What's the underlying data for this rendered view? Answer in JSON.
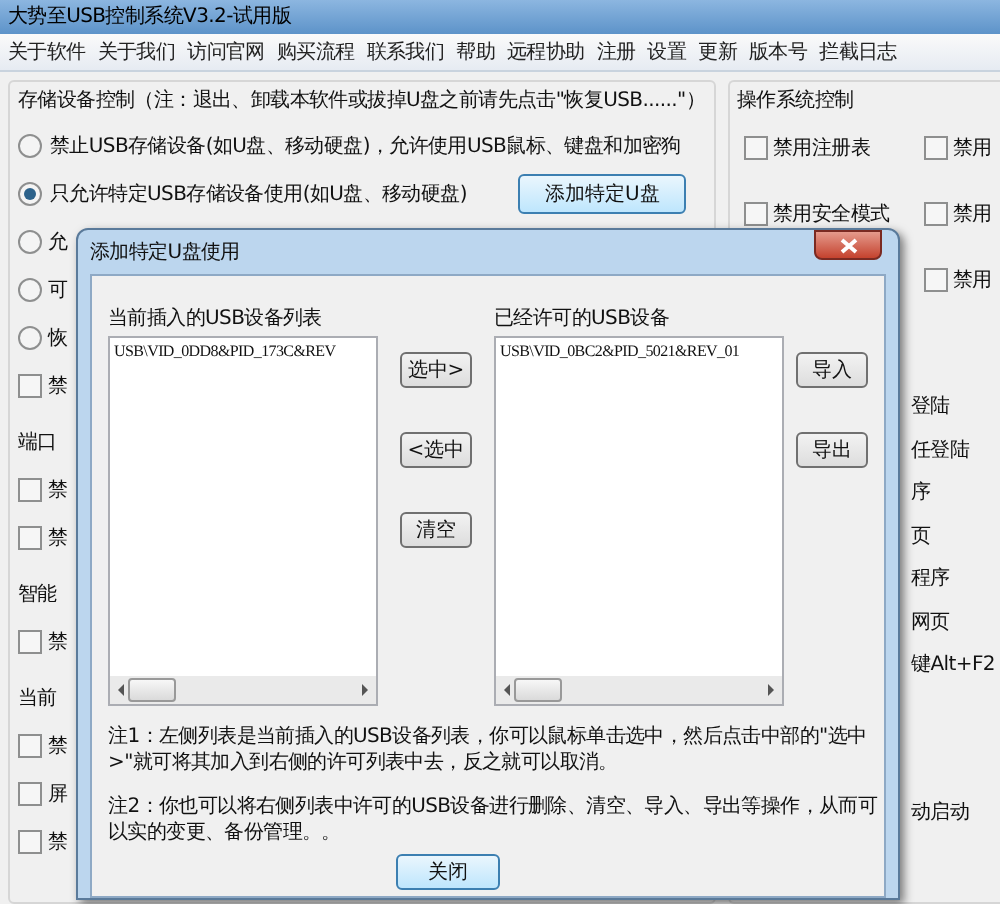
{
  "window": {
    "title": "大势至USB控制系统V3.2-试用版"
  },
  "menu": [
    "关于软件",
    "关于我们",
    "访问官网",
    "购买流程",
    "联系我们",
    "帮助",
    "远程协助",
    "注册",
    "设置",
    "更新",
    "版本号",
    "拦截日志"
  ],
  "storage_control": {
    "title": "存储设备控制（注：退出、卸载本软件或拔掉U盘之前请先点击\"恢复USB......\"）",
    "options": [
      {
        "label": "禁止USB存储设备(如U盘、移动硬盘)，允许使用USB鼠标、键盘和加密狗",
        "selected": false
      },
      {
        "label": "只允许特定USB存储设备使用(如U盘、移动硬盘)",
        "selected": true
      }
    ],
    "add_button": "添加特定U盘",
    "partial_items": [
      {
        "kind": "radio",
        "label": "允",
        "selected": false
      },
      {
        "kind": "radio",
        "label": "可",
        "selected": false
      },
      {
        "kind": "radio",
        "label": "恢",
        "selected": false
      },
      {
        "kind": "checkbox",
        "label": "禁",
        "checked": false
      },
      {
        "kind": "heading",
        "label": "端口"
      },
      {
        "kind": "checkbox",
        "label": "禁",
        "checked": false
      },
      {
        "kind": "checkbox",
        "label": "禁",
        "checked": false
      },
      {
        "kind": "heading",
        "label": "智能"
      },
      {
        "kind": "checkbox",
        "label": "禁",
        "checked": false
      },
      {
        "kind": "heading",
        "label": "当前"
      },
      {
        "kind": "checkbox",
        "label": "禁",
        "checked": false
      },
      {
        "kind": "checkbox",
        "label": "屏",
        "checked": false
      },
      {
        "kind": "checkbox",
        "label": "禁",
        "checked": false
      }
    ]
  },
  "os_control": {
    "title": "操作系统控制",
    "checkboxes": [
      {
        "label": "禁用注册表",
        "checked": false
      },
      {
        "label": "禁用",
        "checked": false
      },
      {
        "label": "禁用安全模式",
        "checked": false
      },
      {
        "label": "禁用",
        "checked": false
      },
      {
        "label": "禁用",
        "checked": false
      }
    ],
    "partial_items": [
      "登陆",
      "任登陆",
      "序",
      "页",
      "程序",
      "网页",
      "键Alt+F2",
      "动启动"
    ]
  },
  "dialog": {
    "title": "添加特定U盘使用",
    "current_list": {
      "label": "当前插入的USB设备列表",
      "items": [
        "USB\\VID_0DD8&PID_173C&REV"
      ]
    },
    "middle_buttons": [
      "选中>",
      "<选中",
      "清空"
    ],
    "allowed_list": {
      "label": "已经许可的USB设备",
      "items": [
        "USB\\VID_0BC2&PID_5021&REV_01"
      ]
    },
    "right_buttons": [
      "导入",
      "导出"
    ],
    "notes": [
      "注1：左侧列表是当前插入的USB设备列表，你可以鼠标单击选中，然后点击中部的\"选中>\"就可将其加入到右侧的许可列表中去，反之就可以取消。",
      "注2：你也可以将右侧列表中许可的USB设备进行删除、清空、导入、导出等操作，从而可以实的变更、备份管理。。"
    ],
    "close_button": "关闭"
  }
}
